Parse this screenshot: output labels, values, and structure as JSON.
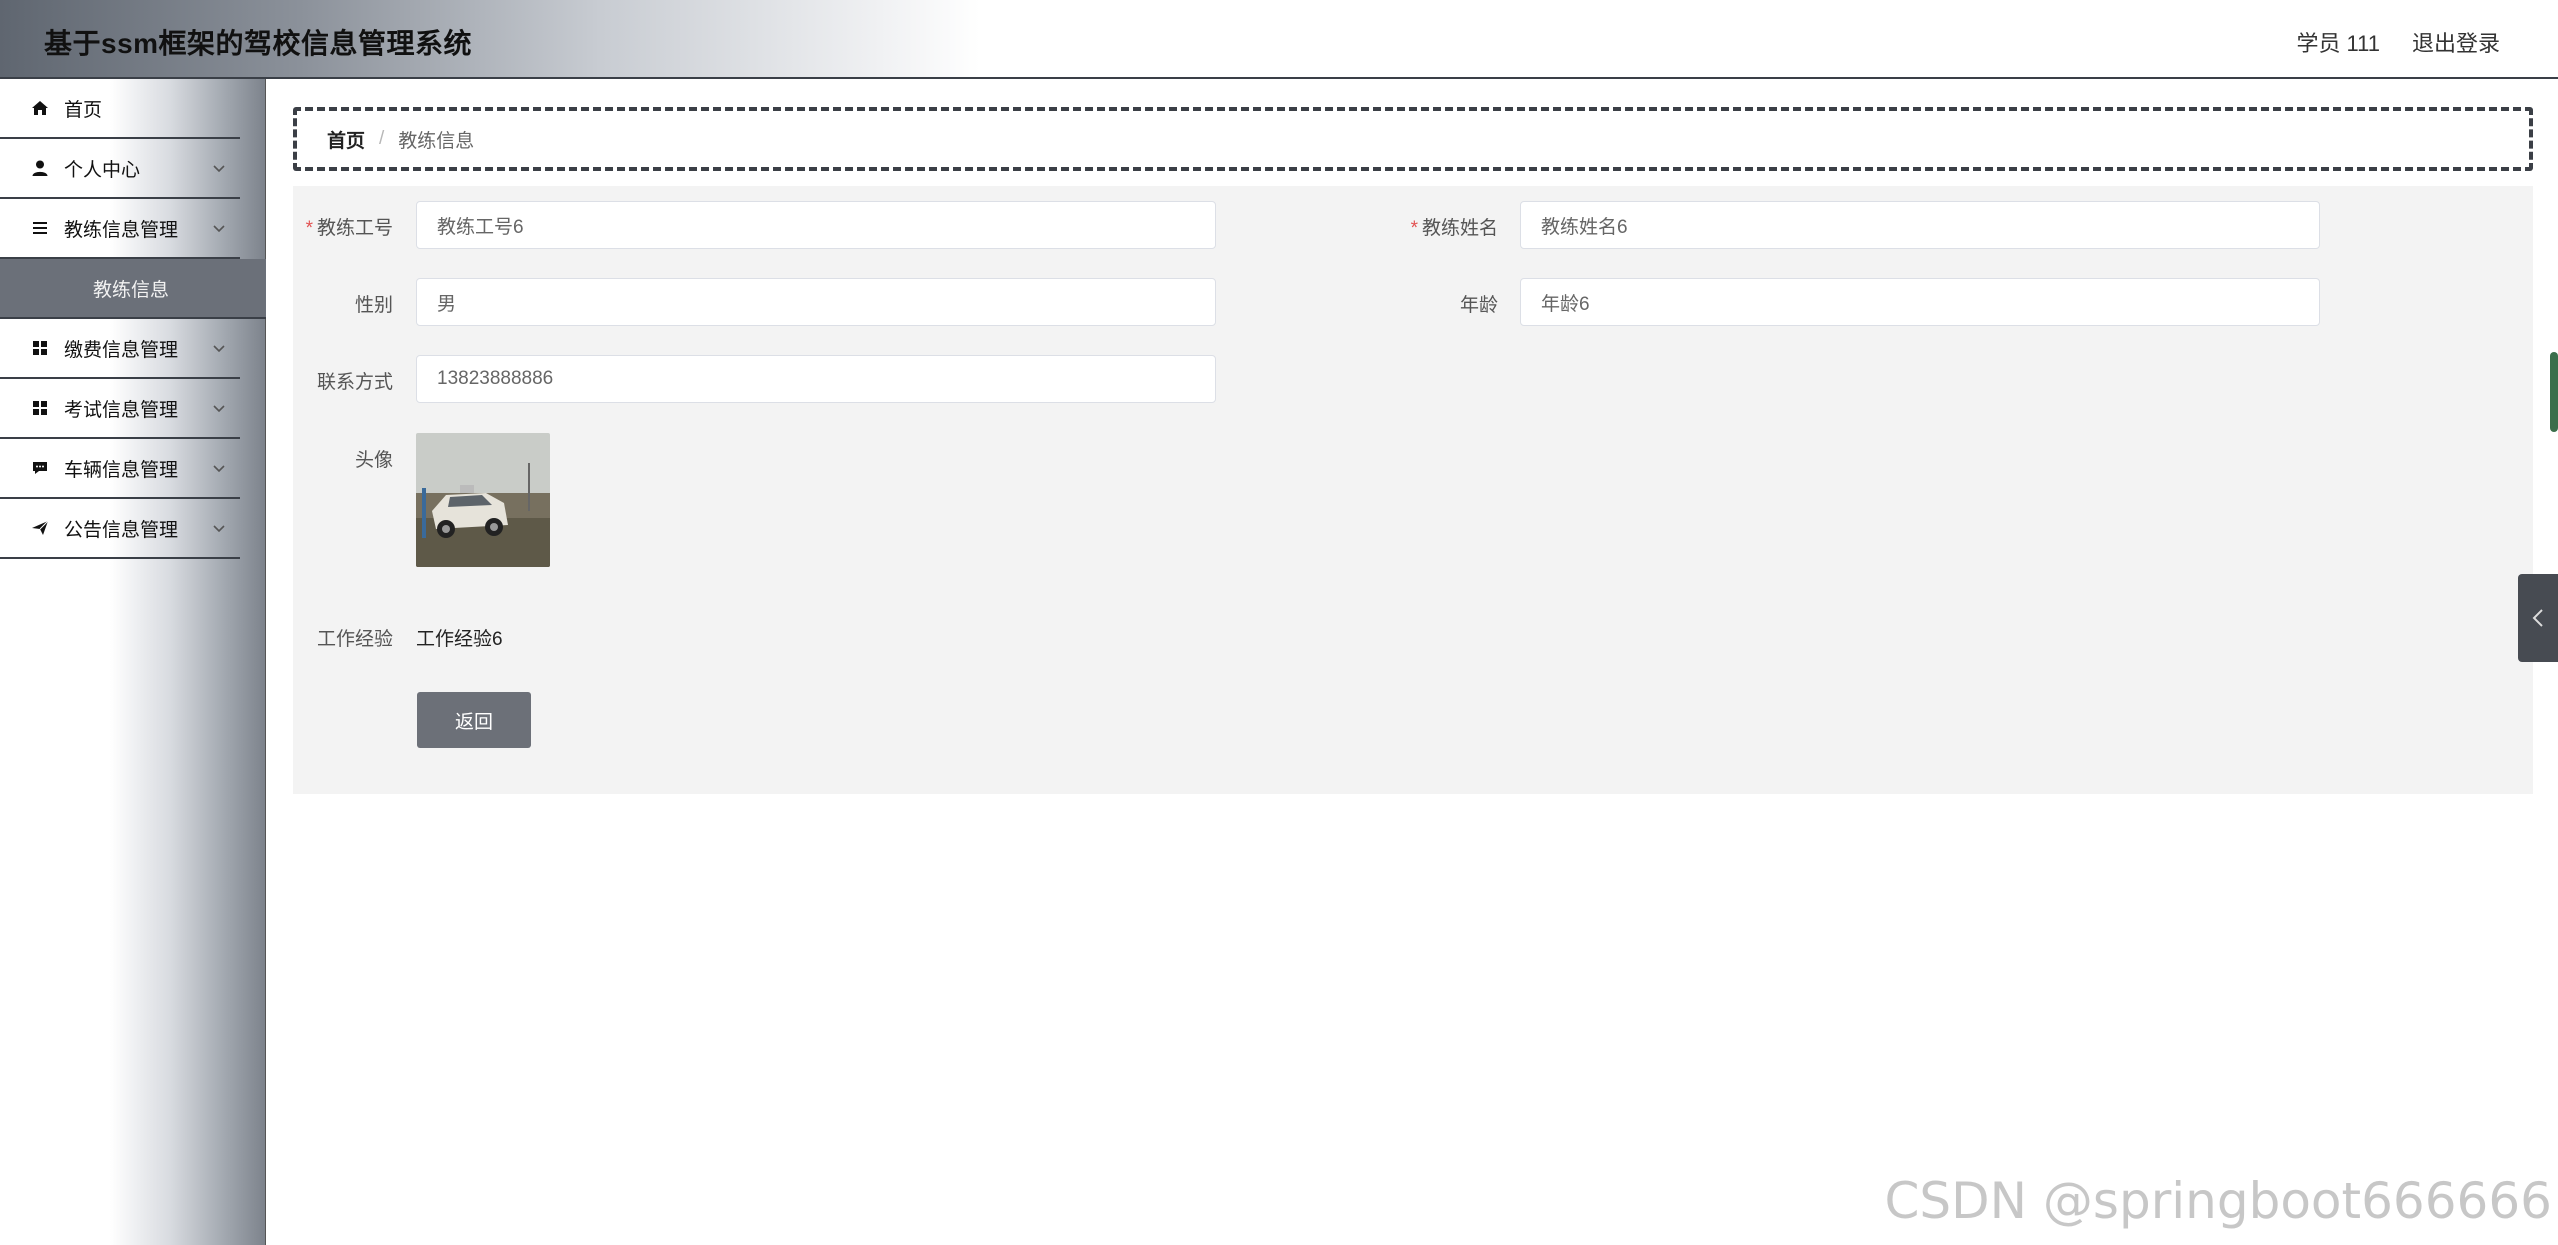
{
  "header": {
    "title": "基于ssm框架的驾校信息管理系统",
    "user": "学员 111",
    "logout": "退出登录"
  },
  "sidebar": {
    "items": [
      {
        "label": "首页",
        "icon": "home-icon"
      },
      {
        "label": "个人中心",
        "icon": "user-icon"
      },
      {
        "label": "教练信息管理",
        "icon": "list-icon"
      },
      {
        "label": "缴费信息管理",
        "icon": "grid-icon"
      },
      {
        "label": "考试信息管理",
        "icon": "grid-icon"
      },
      {
        "label": "车辆信息管理",
        "icon": "chat-icon"
      },
      {
        "label": "公告信息管理",
        "icon": "send-icon"
      }
    ],
    "active_sub": "教练信息"
  },
  "breadcrumb": {
    "home": "首页",
    "separator": "/",
    "current": "教练信息"
  },
  "form": {
    "coach_no": {
      "label": "教练工号",
      "value": "教练工号6"
    },
    "coach_name": {
      "label": "教练姓名",
      "value": "教练姓名6"
    },
    "gender": {
      "label": "性别",
      "value": "男"
    },
    "age": {
      "label": "年龄",
      "value": "年龄6"
    },
    "contact": {
      "label": "联系方式",
      "value": "13823888886"
    },
    "avatar": {
      "label": "头像"
    },
    "experience": {
      "label": "工作经验",
      "value": "工作经验6"
    },
    "back_label": "返回"
  },
  "watermark": "CSDN @springboot666666",
  "colors": {
    "accent": "#6c7078",
    "required": "#e25252",
    "panel": "#f3f3f3"
  }
}
